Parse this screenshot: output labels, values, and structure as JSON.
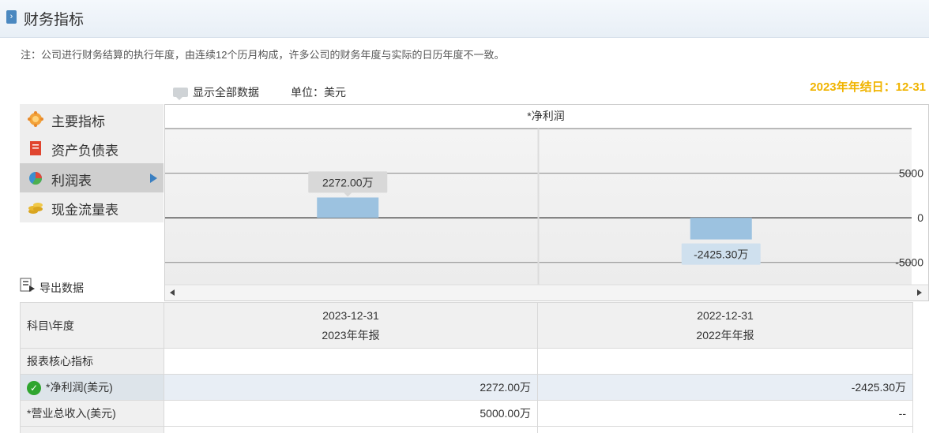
{
  "header": {
    "title": "财务指标"
  },
  "note": "注：公司进行财务结算的执行年度，由连续12个历月构成，许多公司的财务年度与实际的日历年度不一致。",
  "toolbar": {
    "show_all": "显示全部数据",
    "unit": "单位：美元"
  },
  "fiscal_year_end": "2023年年结日：12-31",
  "sidebar": {
    "items": [
      {
        "label": "主要指标",
        "icon": "gear-flower-icon"
      },
      {
        "label": "资产负债表",
        "icon": "document-icon"
      },
      {
        "label": "利润表",
        "icon": "pie-chart-icon",
        "active": true
      },
      {
        "label": "现金流量表",
        "icon": "coins-icon"
      }
    ]
  },
  "export": {
    "label": "导出数据"
  },
  "chart_data": {
    "type": "bar",
    "title": "*净利润",
    "categories": [
      "2023-12-31",
      "2022-12-31"
    ],
    "values": [
      2272.0,
      -2425.3
    ],
    "data_labels": [
      "2272.00万",
      "-2425.30万"
    ],
    "ylim": [
      -7500,
      10000
    ],
    "yticks": [
      5000,
      0,
      -5000
    ],
    "yaxis_position": "right",
    "grid": true,
    "colors": {
      "bar": "#9cc2e0",
      "label_pos_bg": "#d8d8d8",
      "label_neg_bg": "#cfe0ee"
    }
  },
  "table": {
    "header_label": "科目\\年度",
    "columns": [
      {
        "date": "2023-12-31",
        "report": "2023年年报"
      },
      {
        "date": "2022-12-31",
        "report": "2022年年报"
      }
    ],
    "section_label": "报表核心指标",
    "rows": [
      {
        "label": "*净利润(美元)",
        "values": [
          "2272.00万",
          "-2425.30万"
        ],
        "selected": true
      },
      {
        "label": "*营业总收入(美元)",
        "values": [
          "5000.00万",
          "--"
        ]
      }
    ]
  }
}
